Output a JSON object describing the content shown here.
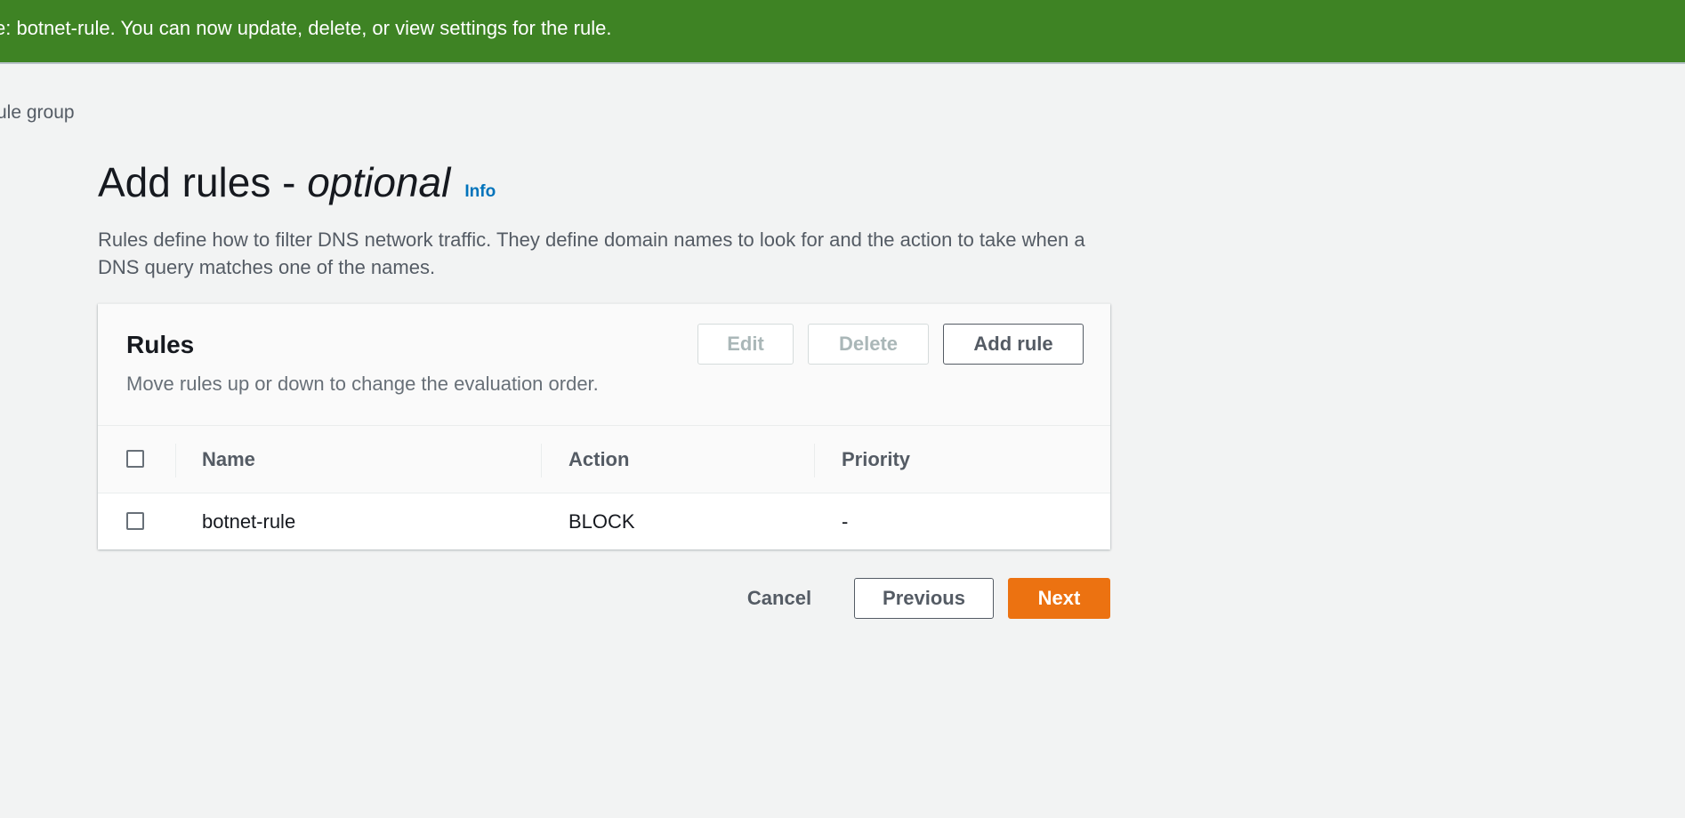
{
  "flash": {
    "message": "e: botnet-rule. You can now update, delete, or view settings for the rule."
  },
  "breadcrumb": {
    "label": "ule group"
  },
  "header": {
    "title_main": "Add rules - ",
    "title_em": "optional",
    "info_link": "Info",
    "description": "Rules define how to filter DNS network traffic. They define domain names to look for and the action to take when a DNS query matches one of the names."
  },
  "rules_panel": {
    "title": "Rules",
    "subtitle": "Move rules up or down to change the evaluation order.",
    "edit_label": "Edit",
    "delete_label": "Delete",
    "add_label": "Add rule",
    "columns": [
      "Name",
      "Action",
      "Priority"
    ],
    "rows": [
      {
        "name": "botnet-rule",
        "action": "BLOCK",
        "priority": "-"
      }
    ]
  },
  "footer": {
    "cancel_label": "Cancel",
    "previous_label": "Previous",
    "next_label": "Next"
  },
  "colors": {
    "flash_bg": "#3e8324",
    "primary_button": "#ec7211",
    "link": "#0073bb"
  }
}
